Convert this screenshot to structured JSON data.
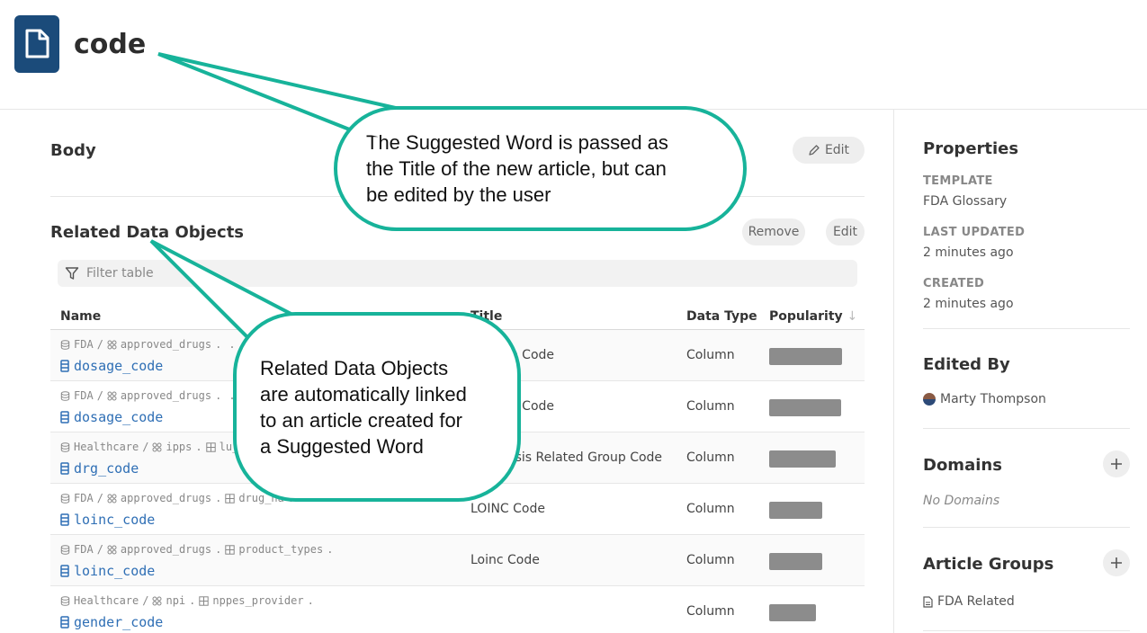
{
  "page": {
    "title": "code"
  },
  "body_section": {
    "title": "Body",
    "edit_label": "Edit"
  },
  "related": {
    "title": "Related Data Objects",
    "remove_label": "Remove",
    "edit_label": "Edit",
    "filter_placeholder": "Filter table",
    "columns": {
      "name": "Name",
      "title": "Title",
      "data_type": "Data Type",
      "popularity": "Popularity",
      "sort_indicator": "↓"
    },
    "rows": [
      {
        "path": [
          "FDA",
          "approved_drugs",
          ""
        ],
        "name": "dosage_code",
        "title": "Dosage Code",
        "data_type": "Column",
        "popularity": 0.9
      },
      {
        "path": [
          "FDA",
          "approved_drugs",
          ""
        ],
        "name": "dosage_code",
        "title": "Dosage Code",
        "data_type": "Column",
        "popularity": 0.89
      },
      {
        "path": [
          "Healthcare",
          "ipps",
          "lu_"
        ],
        "name": "drg_code",
        "title": "Diagnosis Related Group Code",
        "data_type": "Column",
        "popularity": 0.82
      },
      {
        "path": [
          "FDA",
          "approved_drugs",
          "drug_na"
        ],
        "name": "loinc_code",
        "title": "LOINC Code",
        "data_type": "Column",
        "popularity": 0.66
      },
      {
        "path": [
          "FDA",
          "approved_drugs",
          "product_types"
        ],
        "name": "loinc_code",
        "title": "Loinc Code",
        "data_type": "Column",
        "popularity": 0.66
      },
      {
        "path": [
          "Healthcare",
          "npi",
          "nppes_provider"
        ],
        "name": "gender_code",
        "title": "",
        "data_type": "Column",
        "popularity": 0.58
      }
    ]
  },
  "sidebar": {
    "properties_title": "Properties",
    "template_label": "TEMPLATE",
    "template_value": "FDA Glossary",
    "last_updated_label": "LAST UPDATED",
    "last_updated_value": "2 minutes ago",
    "created_label": "CREATED",
    "created_value": "2 minutes ago",
    "edited_by_title": "Edited By",
    "editor_name": "Marty Thompson",
    "domains_title": "Domains",
    "domains_empty": "No Domains",
    "article_groups_title": "Article Groups",
    "article_group_item": "FDA Related"
  },
  "callouts": {
    "title_note": [
      "The Suggested Word is passed as",
      "the Title of the new article, but can",
      "be edited by the user"
    ],
    "related_note": [
      "Related Data Objects",
      "are automatically linked",
      "to an article created for",
      "a Suggested Word"
    ]
  },
  "colors": {
    "accent": "#17b39a",
    "brand": "#1b4b7a",
    "link": "#2f6fb5",
    "bar": "#8c8c8c"
  },
  "icons": [
    "document-icon",
    "pencil-icon",
    "filter-icon",
    "database-icon",
    "schema-icon",
    "table-icon",
    "column-icon",
    "plus-icon",
    "file-icon",
    "avatar"
  ]
}
